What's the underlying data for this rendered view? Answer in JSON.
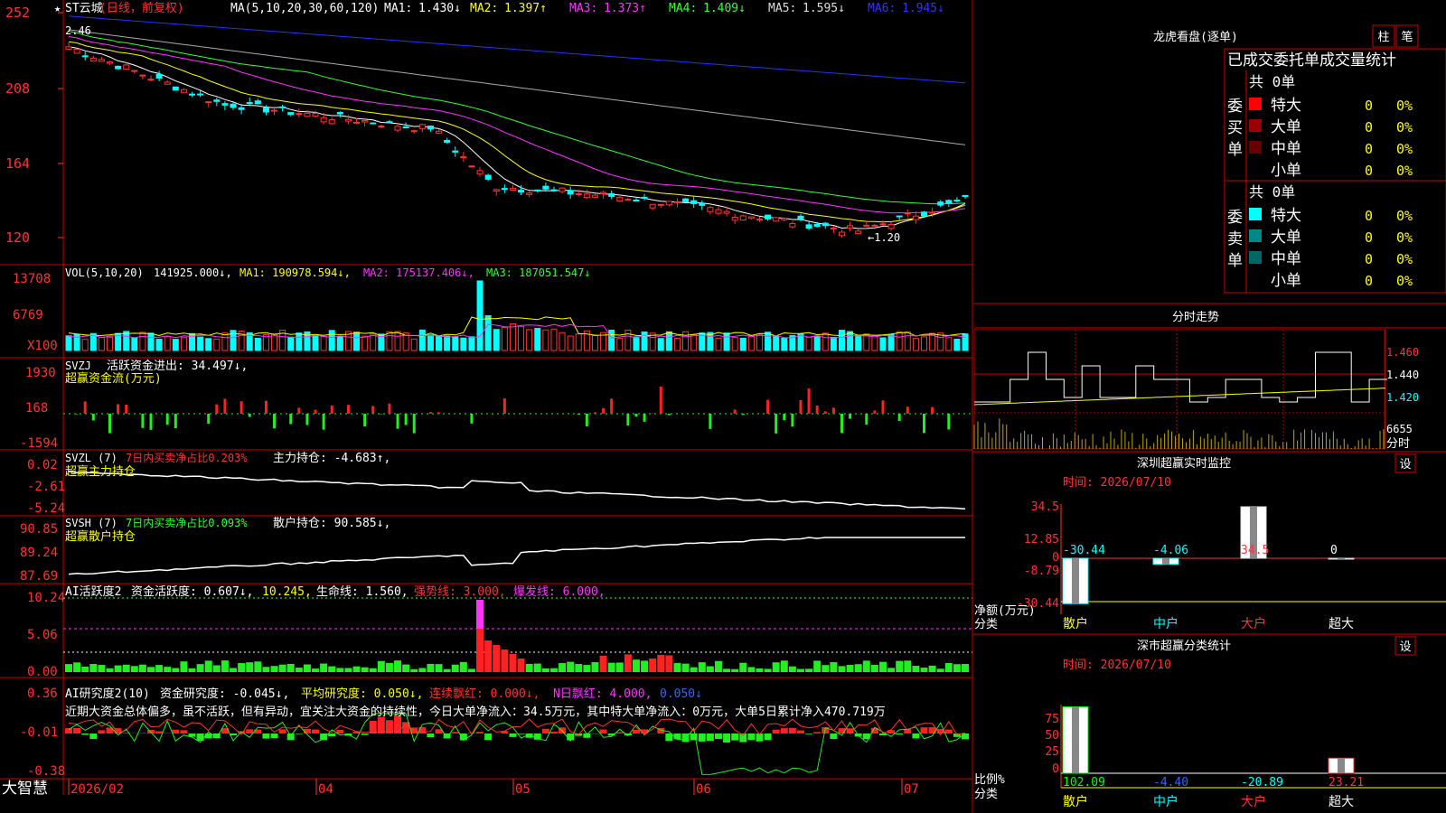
{
  "app": {
    "brand": "大智慧"
  },
  "main": {
    "name": "ST云城",
    "mode": "(日线，前复权)",
    "ma_header": "MA(5,10,20,30,60,120)",
    "ma": [
      {
        "label": "MA1:",
        "value": "1.430↓",
        "color": "#ffffff"
      },
      {
        "label": "MA2:",
        "value": "1.397↑",
        "color": "#ffff00"
      },
      {
        "label": "MA3:",
        "value": "1.373↑",
        "color": "#ff33ff"
      },
      {
        "label": "MA4:",
        "value": "1.409↓",
        "color": "#33ff33"
      },
      {
        "label": "MA5:",
        "value": "1.595↓",
        "color": "#dddddd"
      },
      {
        "label": "MA6:",
        "value": "1.945↓",
        "color": "#3333ff"
      }
    ],
    "y_ticks": [
      "252",
      "208",
      "164",
      "120"
    ],
    "high_mark": "2.46",
    "low_mark": "←1.20"
  },
  "vol": {
    "header": "VOL(5,10,20)",
    "value": "141925.000↓,",
    "ma1": "MA1: 190978.594↓,",
    "ma2": "MA2: 175137.406↓,",
    "ma3": "MA3: 187051.547↓",
    "y_ticks": [
      "13708",
      "6769",
      "X100"
    ]
  },
  "svzj": {
    "header": "SVZJ",
    "label": "活跃资金进出: 34.497↓,",
    "sub": "超赢资金流(万元)",
    "y_ticks": [
      "1930",
      "168",
      "-1594"
    ]
  },
  "svzl": {
    "header": "SVZL (7)",
    "ratio": "7日内买卖净占比0.203%",
    "main": "主力持仓: -4.683↑,",
    "sub": "超赢主力持仓",
    "y_ticks": [
      "0.02",
      "-2.61",
      "-5.24"
    ]
  },
  "svsh": {
    "header": "SVSH (7)",
    "ratio": "7日内买卖净占比0.093%",
    "main": "散户持仓: 90.585↓,",
    "sub": "超赢散户持仓",
    "y_ticks": [
      "90.85",
      "89.24",
      "87.69"
    ]
  },
  "ai1": {
    "header": "AI活跃度2",
    "a": "资金活跃度: 0.607↓,",
    "b": "10.245,",
    "c": "生命线: 1.560,",
    "d": "强势线: 3.000,",
    "e": "爆发线: 6.000,",
    "y_ticks": [
      "10.24",
      "5.06",
      "0.00"
    ]
  },
  "ai2": {
    "header": "AI研究度2(10)",
    "a": "资金研究度: -0.045↓,",
    "b": "平均研究度: 0.050↓,",
    "c": "连续飘红: 0.000↓,",
    "d": "N日飘红: 4.000,",
    "e": "0.050↓",
    "note": "近期大资金总体偏多，虽不活跃，但有异动，宜关注大资金的持续性，今日大单净流入：34.5万元，其中特大单净流入：0万元，大单5日累计净入470.719万",
    "y_ticks": [
      "0.36",
      "-0.01",
      "-0.38"
    ]
  },
  "x_axis": [
    "2026/02",
    "04",
    "05",
    "06",
    "07"
  ],
  "right": {
    "lhkp_title": "龙虎看盘(逐单)",
    "btn_zhu": "柱",
    "btn_bi": "笔",
    "stats_title": "已成交委托单成交量统计",
    "buy_label": "委买单",
    "sell_label": "委卖单",
    "buy_total": "共 0单",
    "sell_total": "共 0单",
    "buy_rows": [
      {
        "name": "特大",
        "count": "0",
        "pct": "0%",
        "color": "#ff0000"
      },
      {
        "name": "大单",
        "count": "0",
        "pct": "0%",
        "color": "#990000"
      },
      {
        "name": "中单",
        "count": "0",
        "pct": "0%",
        "color": "#660000"
      },
      {
        "name": "小单",
        "count": "0",
        "pct": "0%",
        "color": ""
      }
    ],
    "sell_rows": [
      {
        "name": "特大",
        "count": "0",
        "pct": "0%",
        "color": "#00ffff"
      },
      {
        "name": "大单",
        "count": "0",
        "pct": "0%",
        "color": "#008888"
      },
      {
        "name": "中单",
        "count": "0",
        "pct": "0%",
        "color": "#006666"
      },
      {
        "name": "小单",
        "count": "0",
        "pct": "0%",
        "color": ""
      }
    ],
    "intraday_title": "分时走势",
    "intraday_prices": [
      "1.460",
      "1.440",
      "1.420"
    ],
    "intraday_vol": "6655",
    "intraday_tag": "分时",
    "monitor_title": "深圳超赢实时监控",
    "monitor_time": "时间: 2026/07/10",
    "set_label": "设",
    "monitor_y": [
      "34.5",
      "12.85",
      "0",
      "-8.79",
      "-30.44"
    ],
    "monitor_vals": [
      "-30.44",
      "-4.06",
      "34.5",
      "0"
    ],
    "monitor_unit": "净额(万元)",
    "monitor_class": "分类",
    "cats": [
      "散户",
      "中户",
      "大户",
      "超大"
    ],
    "stats2_title": "深市超赢分类统计",
    "stats2_time": "时间: 2026/07/10",
    "stats2_y": [
      "75",
      "50",
      "25",
      "0"
    ],
    "stats2_vals": [
      "102.09",
      "-4.40",
      "-20.89",
      "23.21"
    ],
    "stats2_unit": "比例%",
    "stats2_class": "分类"
  }
}
